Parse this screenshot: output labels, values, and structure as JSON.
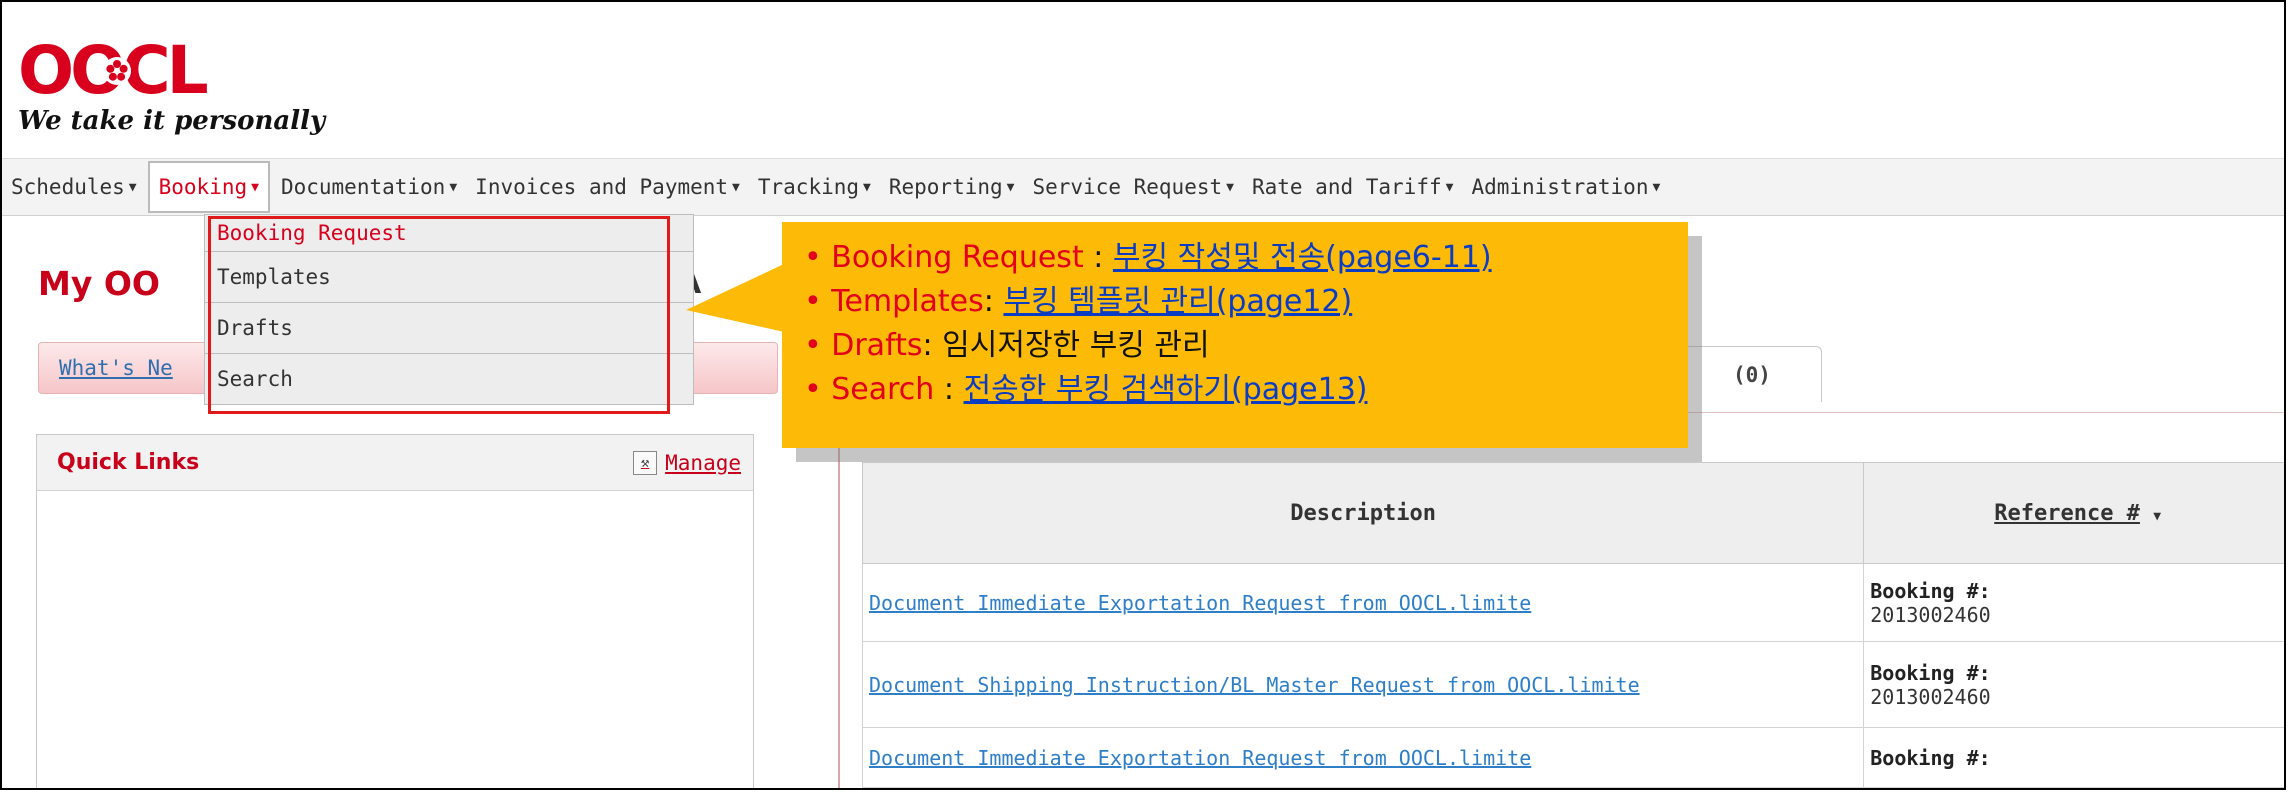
{
  "brand": {
    "logo_text": "OOCL",
    "tagline": "We take it personally",
    "brand_color": "#d8001c"
  },
  "nav": {
    "items": [
      {
        "label": "Schedules"
      },
      {
        "label": "Booking"
      },
      {
        "label": "Documentation"
      },
      {
        "label": "Invoices and Payment"
      },
      {
        "label": "Tracking"
      },
      {
        "label": "Reporting"
      },
      {
        "label": "Service Request"
      },
      {
        "label": "Rate and Tariff"
      },
      {
        "label": "Administration"
      }
    ],
    "active": "Booking"
  },
  "booking_menu": {
    "items": [
      {
        "label": "Booking Request"
      },
      {
        "label": "Templates"
      },
      {
        "label": "Drafts"
      },
      {
        "label": "Search"
      }
    ]
  },
  "page": {
    "title": "My OO",
    "title_tail": "A"
  },
  "whats_new": {
    "label": "What's Ne"
  },
  "tab_count": {
    "label": "(0)"
  },
  "quick_links": {
    "title": "Quick Links",
    "manage_label": "Manage"
  },
  "table": {
    "headers": {
      "description": "Description",
      "reference": "Reference #"
    },
    "rows": [
      {
        "description": "Document Immediate Exportation Request from OOCL.limite",
        "ref_label": "Booking #:",
        "ref_value": "2013002460"
      },
      {
        "description": "Document Shipping Instruction/BL Master Request from OOCL.limite",
        "ref_label": "Booking #:",
        "ref_value": "2013002460"
      },
      {
        "description": "Document Immediate Exportation Request from OOCL.limite",
        "ref_label": "Booking #:",
        "ref_value": ""
      }
    ]
  },
  "callout": {
    "bullet": "•",
    "lines": [
      {
        "key": "Booking Request",
        "sep": " : ",
        "text": "부킹 작성및 전송(page6-11)",
        "is_link": true
      },
      {
        "key": "Templates",
        "sep": ": ",
        "text": "부킹 템플릿 관리(page12)",
        "is_link": true
      },
      {
        "key": "Drafts",
        "sep": ": ",
        "text": "임시저장한 부킹 관리",
        "is_link": false
      },
      {
        "key": "Search",
        "sep": " : ",
        "text": "전송한 부킹 검색하기(page13)",
        "is_link": true
      }
    ],
    "background": "#fdbb08",
    "key_color": "#e2001a",
    "link_color": "#0b3cc4"
  }
}
